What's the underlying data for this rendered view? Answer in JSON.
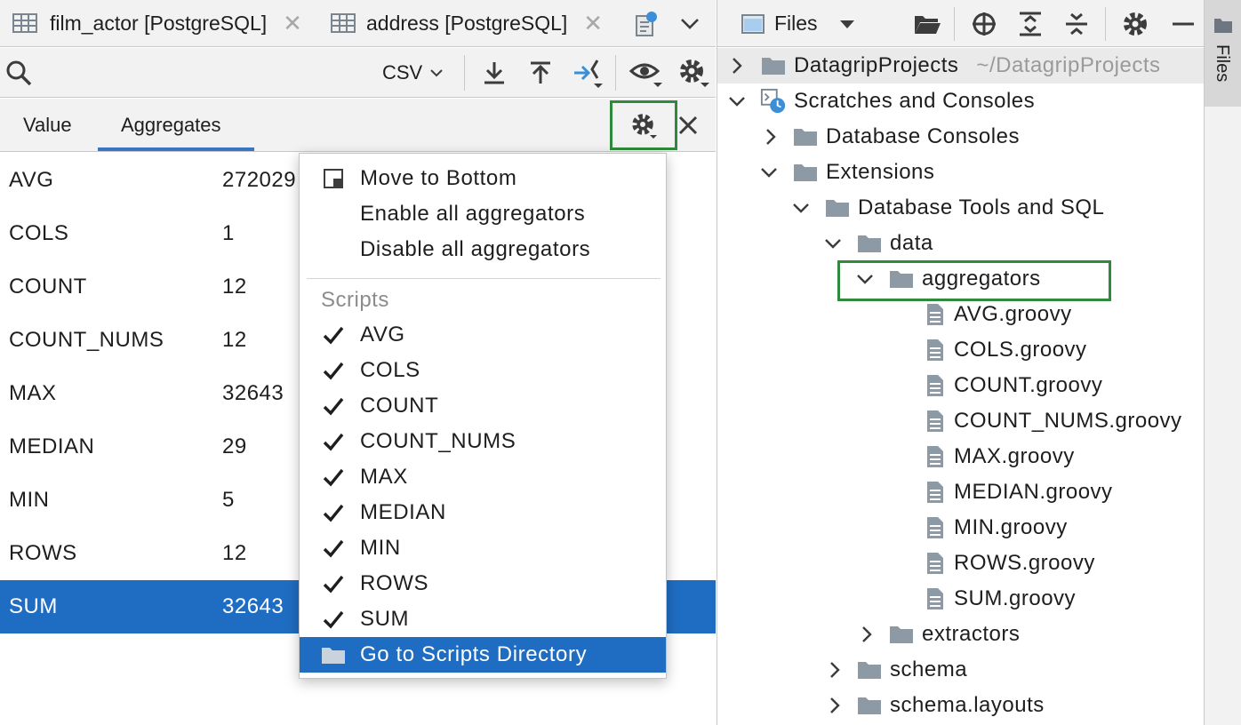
{
  "left_tabs": [
    {
      "label": "film_actor [PostgreSQL]"
    },
    {
      "label": "address [PostgreSQL]"
    }
  ],
  "toolbar": {
    "format": "CSV"
  },
  "subtabs": [
    {
      "label": "Value"
    },
    {
      "label": "Aggregates"
    }
  ],
  "aggregates": [
    {
      "name": "AVG",
      "value": "272029"
    },
    {
      "name": "COLS",
      "value": "1"
    },
    {
      "name": "COUNT",
      "value": "12"
    },
    {
      "name": "COUNT_NUMS",
      "value": "12"
    },
    {
      "name": "MAX",
      "value": "32643"
    },
    {
      "name": "MEDIAN",
      "value": "29"
    },
    {
      "name": "MIN",
      "value": "5"
    },
    {
      "name": "ROWS",
      "value": "12"
    },
    {
      "name": "SUM",
      "value": "32643"
    }
  ],
  "menu": {
    "items_top": [
      "Move to Bottom",
      "Enable all aggregators",
      "Disable all aggregators"
    ],
    "scripts_header": "Scripts",
    "scripts": [
      "AVG",
      "COLS",
      "COUNT",
      "COUNT_NUMS",
      "MAX",
      "MEDIAN",
      "MIN",
      "ROWS",
      "SUM"
    ],
    "go_to": "Go to Scripts Directory"
  },
  "files_panel": {
    "title": "Files",
    "stripe_label": "Files",
    "tree": [
      {
        "label": "DatagripProjects",
        "sub": "~/DatagripProjects"
      },
      {
        "label": "Scratches and Consoles"
      },
      {
        "label": "Database Consoles"
      },
      {
        "label": "Extensions"
      },
      {
        "label": "Database Tools and SQL"
      },
      {
        "label": "data"
      },
      {
        "label": "aggregators"
      },
      {
        "label": "AVG.groovy"
      },
      {
        "label": "COLS.groovy"
      },
      {
        "label": "COUNT.groovy"
      },
      {
        "label": "COUNT_NUMS.groovy"
      },
      {
        "label": "MAX.groovy"
      },
      {
        "label": "MEDIAN.groovy"
      },
      {
        "label": "MIN.groovy"
      },
      {
        "label": "ROWS.groovy"
      },
      {
        "label": "SUM.groovy"
      },
      {
        "label": "extractors"
      },
      {
        "label": "schema"
      },
      {
        "label": "schema.layouts"
      }
    ]
  },
  "colors": {
    "accent": "#1f6dc2",
    "highlight_border": "#2f8a3c"
  }
}
